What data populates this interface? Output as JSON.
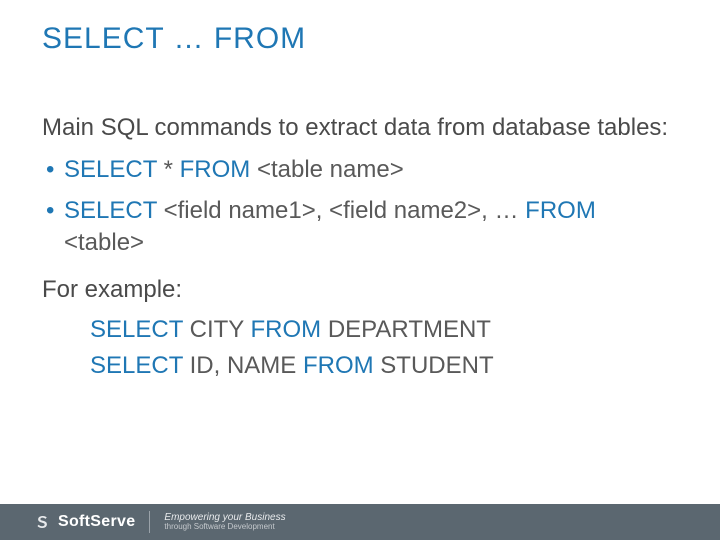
{
  "title": "SELECT … FROM",
  "leadText": "Main SQL commands to extract data from database tables:",
  "bullets": [
    {
      "kw1": "SELECT ",
      "mid1": "* ",
      "kw2": "FROM ",
      "tail": "<table name>"
    },
    {
      "kw1": "SELECT ",
      "mid1": "<field name1>, <field name2>, … ",
      "kw2": "FROM ",
      "tail": "<table>"
    }
  ],
  "forExample": "For example:",
  "examples": [
    {
      "kw1": "SELECT ",
      "mid": "CITY ",
      "kw2": "FROM ",
      "tail": "DEPARTMENT"
    },
    {
      "kw1": "SELECT ",
      "mid": "ID, NAME ",
      "kw2": "FROM ",
      "tail": "STUDENT"
    }
  ],
  "footer": {
    "brand": "SoftServe",
    "tagline1": "Empowering your Business",
    "tagline2": "through Software Development"
  }
}
